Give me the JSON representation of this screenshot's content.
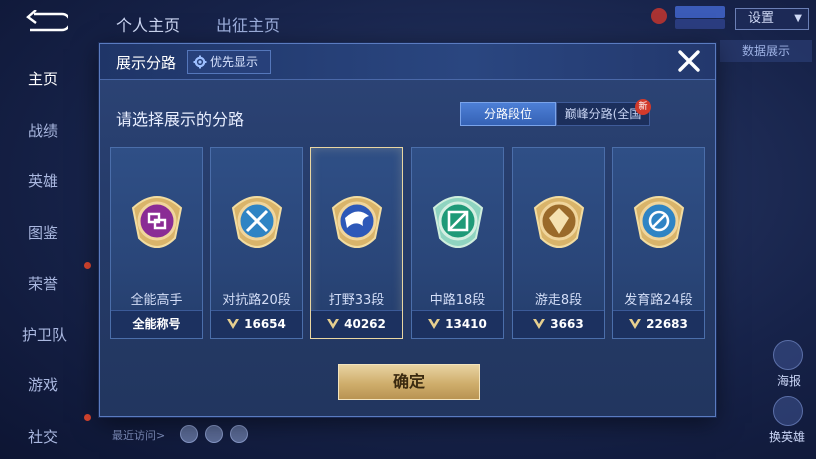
{
  "background": {
    "tabs": [
      "个人主页",
      "出征主页"
    ],
    "setting_label": "设置",
    "data_button": "数据展示",
    "sidebar": [
      "主页",
      "战绩",
      "英雄",
      "图鉴",
      "荣誉",
      "护卫队",
      "游戏",
      "社交"
    ],
    "recent_label": "最近访问>",
    "right_labels": [
      "海报",
      "换英雄"
    ]
  },
  "modal": {
    "title": "展示分路",
    "priority_label": "优先显示",
    "subtitle": "请选择展示的分路",
    "tabs": {
      "active": "分路段位",
      "inactive": "巅峰分路(全国",
      "new_badge": "新"
    },
    "cards": [
      {
        "role": "全能高手",
        "footer": "全能称号",
        "color": "#b13bbf"
      },
      {
        "role": "对抗路20段",
        "footer": "16654",
        "color": "#3aa0d8"
      },
      {
        "role": "打野33段",
        "footer": "40262",
        "color": "#3d6fd0"
      },
      {
        "role": "中路18段",
        "footer": "13410",
        "color": "#2fb38f"
      },
      {
        "role": "游走8段",
        "footer": "3663",
        "color": "#b88a3a"
      },
      {
        "role": "发育路24段",
        "footer": "22683",
        "color": "#3aa0d8"
      }
    ],
    "selected_index": 2,
    "confirm_label": "确定"
  }
}
